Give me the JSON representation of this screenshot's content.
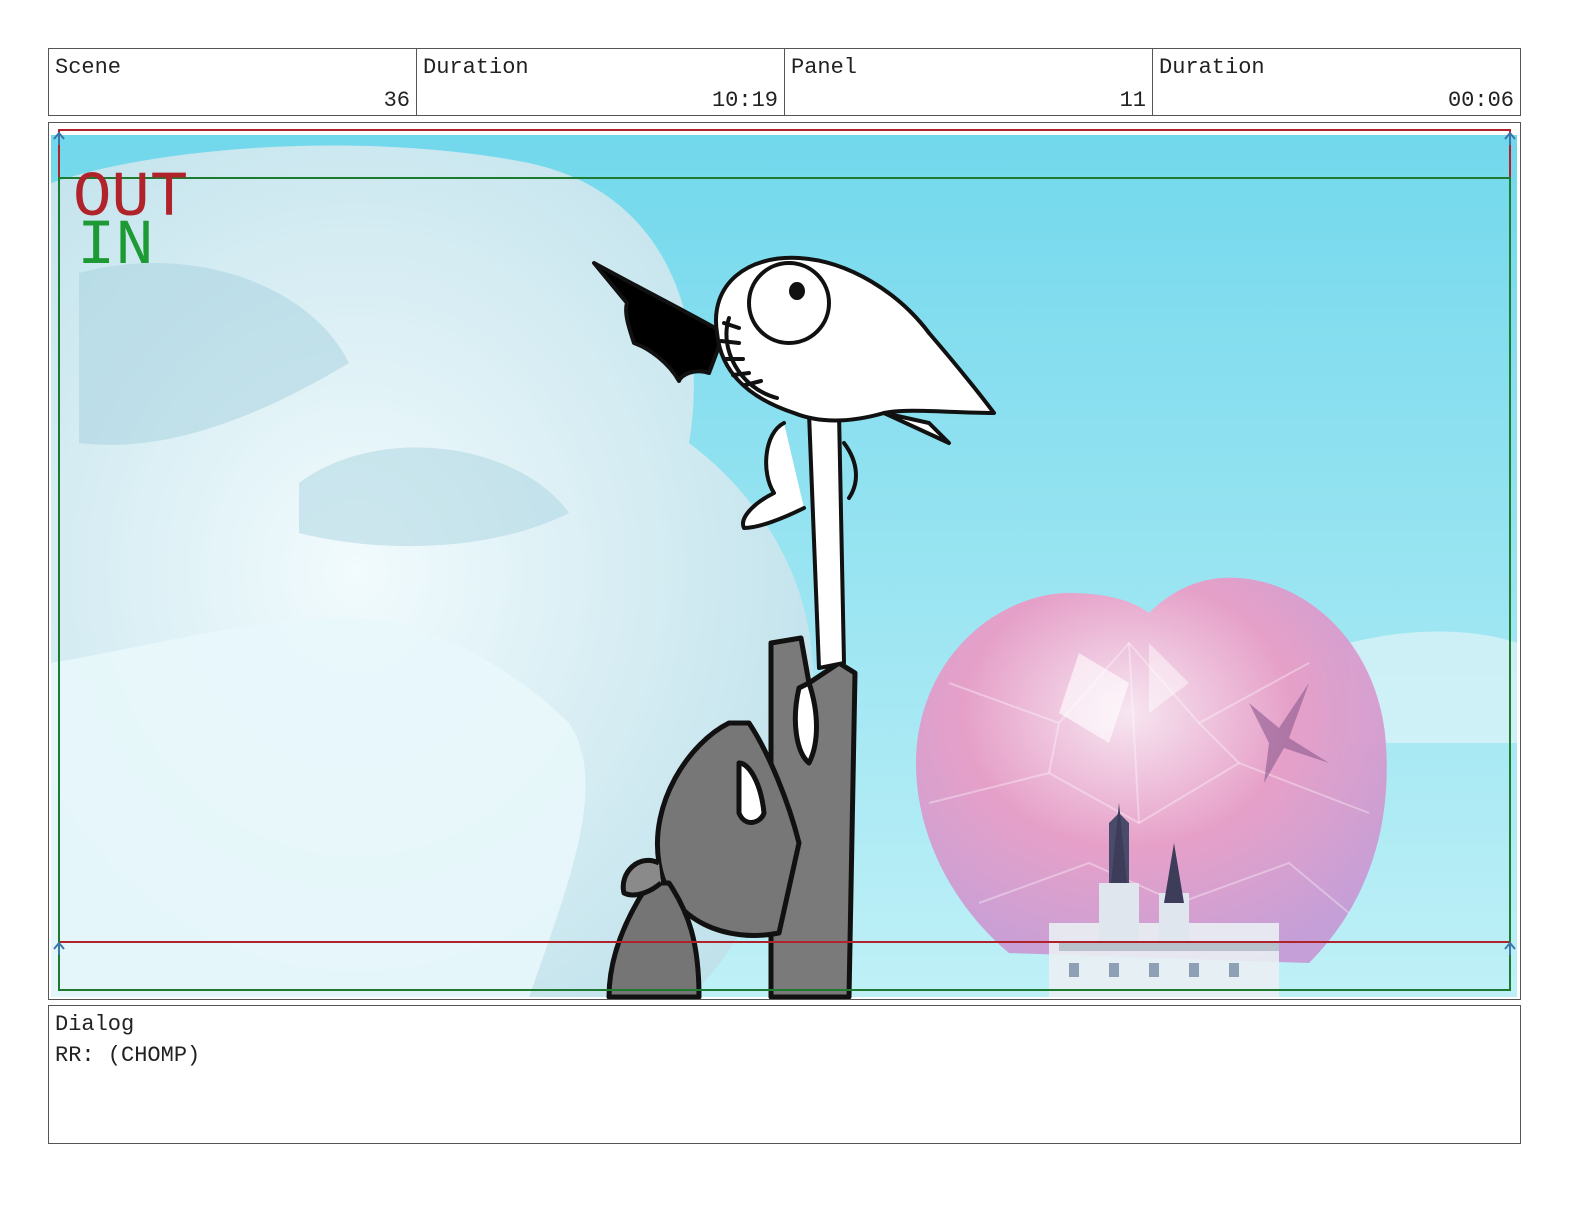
{
  "header": {
    "scene_label": "Scene",
    "scene_value": "36",
    "scene_duration_label": "Duration",
    "scene_duration_value": "10:19",
    "panel_label": "Panel",
    "panel_value": "11",
    "panel_duration_label": "Duration",
    "panel_duration_value": "00:06"
  },
  "panel": {
    "out_label": "OUT",
    "in_label": "IN",
    "colors": {
      "out_frame": "#b0232b",
      "in_frame": "#1e7a2e",
      "sky": "#7ddcec",
      "crystal": "#e79ac4"
    }
  },
  "dialog": {
    "label": "Dialog",
    "text": "RR: (CHOMP)"
  }
}
